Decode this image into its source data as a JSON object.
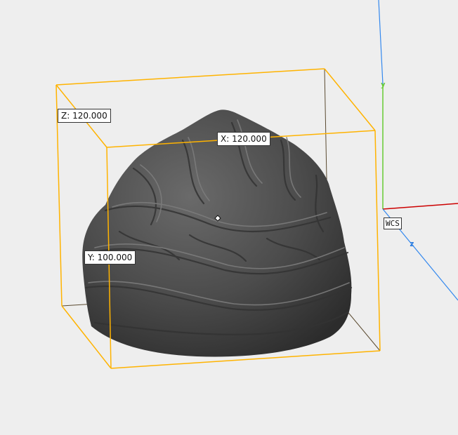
{
  "viewport": {
    "background": "#eeeeee",
    "bbox_color": "#ffb300",
    "model_color": "#4e4e4e"
  },
  "dimensions": {
    "x": "X: 120.000",
    "y": "Y: 100.000",
    "z": "Z: 120.000"
  },
  "axes": {
    "y_label": "y",
    "z_label": "z",
    "wcs_label": "WCS",
    "x_color": "#cc0000",
    "y_color": "#66cc33",
    "z_color": "#3388ee"
  },
  "pivot": {
    "icon": "pivot-diamond-icon"
  }
}
